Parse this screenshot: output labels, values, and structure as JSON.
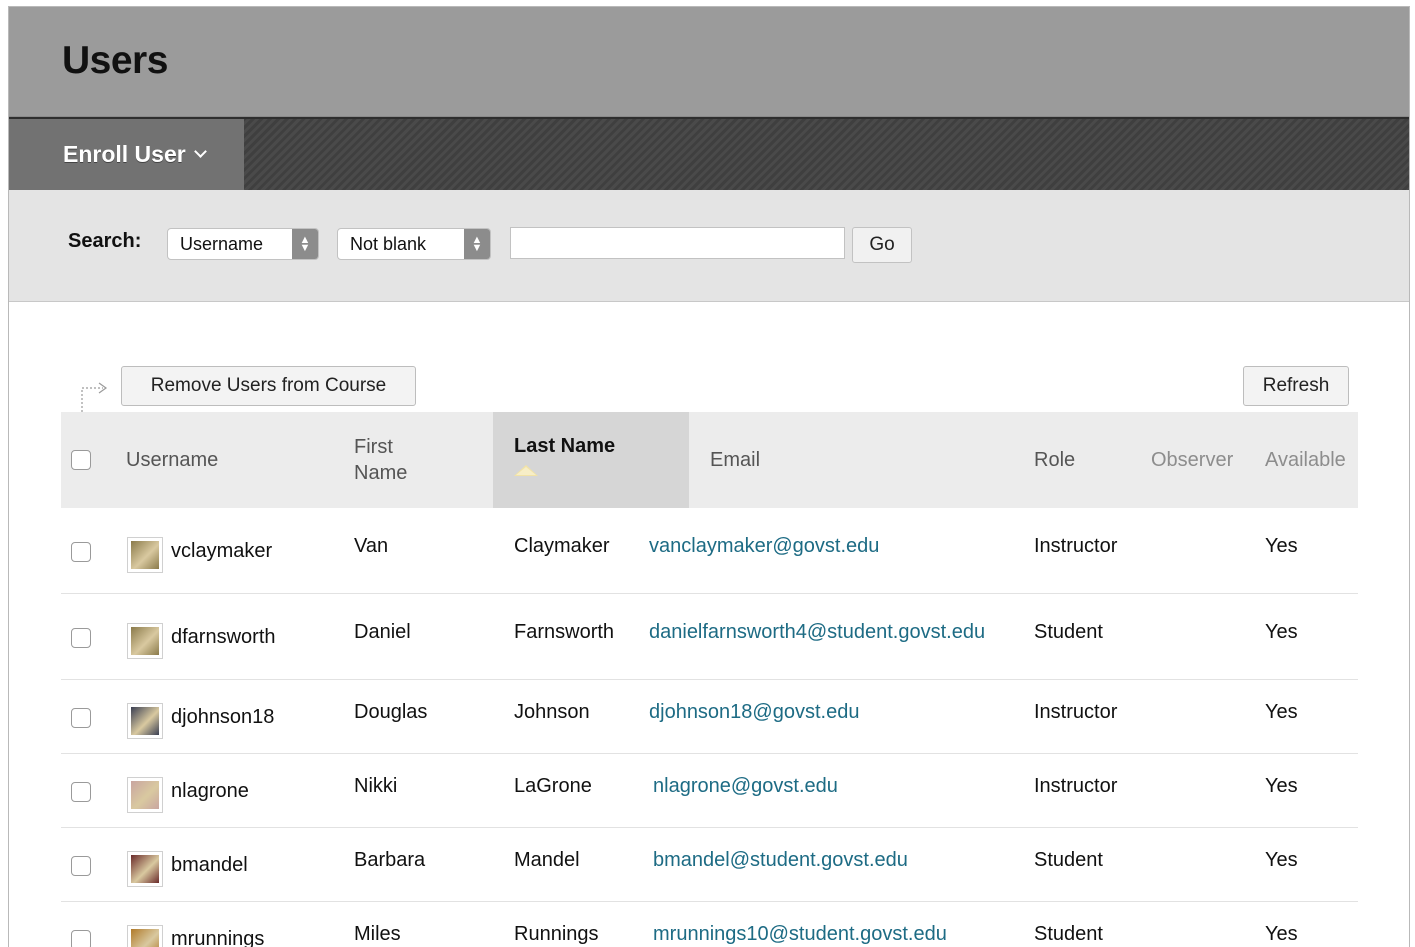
{
  "page": {
    "title": "Users"
  },
  "action_bar": {
    "enroll_label": "Enroll User"
  },
  "search": {
    "label": "Search:",
    "field_value": "Username",
    "operator_value": "Not blank",
    "input_value": "",
    "go_label": "Go"
  },
  "actions": {
    "remove_label": "Remove Users from Course",
    "refresh_label": "Refresh"
  },
  "columns": {
    "username": "Username",
    "first_name_1": "First",
    "first_name_2": "Name",
    "last_name": "Last Name",
    "email": "Email",
    "role": "Role",
    "observer": "Observer",
    "available": "Available"
  },
  "rows": [
    {
      "username": "vclaymaker",
      "first": "Van",
      "last": "Claymaker",
      "email": "vanclaymaker@govst.edu",
      "role": "Instructor",
      "available": "Yes",
      "avatar_color": "#8a7a4a"
    },
    {
      "username": "dfarnsworth",
      "first": "Daniel",
      "last": "Farnsworth",
      "email": "danielfarnsworth4@student.govst.edu",
      "role": "Student",
      "available": "Yes",
      "avatar_color": "#8a7a4a"
    },
    {
      "username": "djohnson18",
      "first": "Douglas",
      "last": "Johnson",
      "email": "djohnson18@govst.edu",
      "role": "Instructor",
      "available": "Yes",
      "avatar_color": "#3a3f52"
    },
    {
      "username": "nlagrone",
      "first": "Nikki",
      "last": "LaGrone",
      "email": "nlagrone@govst.edu",
      "role": "Instructor",
      "available": "Yes",
      "avatar_color": "#c9a5a0"
    },
    {
      "username": "bmandel",
      "first": "Barbara",
      "last": "Mandel",
      "email": "bmandel@student.govst.edu",
      "role": "Student",
      "available": "Yes",
      "avatar_color": "#6a2a2a"
    },
    {
      "username": "mrunnings",
      "first": "Miles",
      "last": "Runnings",
      "email": "mrunnings10@student.govst.edu",
      "role": "Student",
      "available": "Yes",
      "avatar_color": "#b07a2a"
    }
  ]
}
